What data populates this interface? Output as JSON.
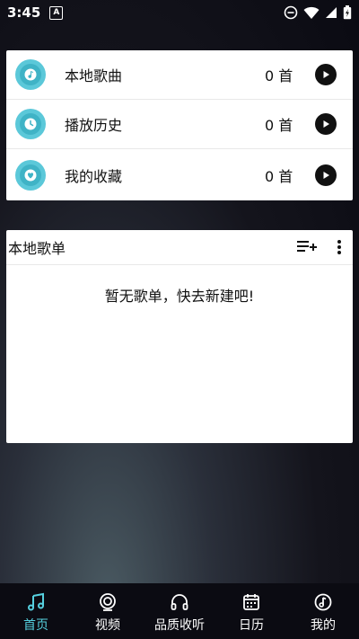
{
  "status": {
    "time": "3:45",
    "notif_glyph": "A"
  },
  "list": {
    "items": [
      {
        "label": "本地歌曲",
        "count": "0 首",
        "icon": "music-note-icon"
      },
      {
        "label": "播放历史",
        "count": "0 首",
        "icon": "clock-icon"
      },
      {
        "label": "我的收藏",
        "count": "0 首",
        "icon": "heart-icon"
      }
    ]
  },
  "playlists": {
    "title": "本地歌单",
    "empty_text": "暂无歌单，快去新建吧!"
  },
  "nav": {
    "items": [
      {
        "label": "首页",
        "icon": "music-note-icon",
        "active": true
      },
      {
        "label": "视频",
        "icon": "video-icon"
      },
      {
        "label": "品质收听",
        "icon": "headphones-icon"
      },
      {
        "label": "日历",
        "icon": "calendar-icon"
      },
      {
        "label": "我的",
        "icon": "profile-music-icon"
      }
    ]
  },
  "colors": {
    "accent": "#56d0df",
    "icon_bg": "#5bc8d9",
    "icon_inner": "#3fb3c6"
  }
}
